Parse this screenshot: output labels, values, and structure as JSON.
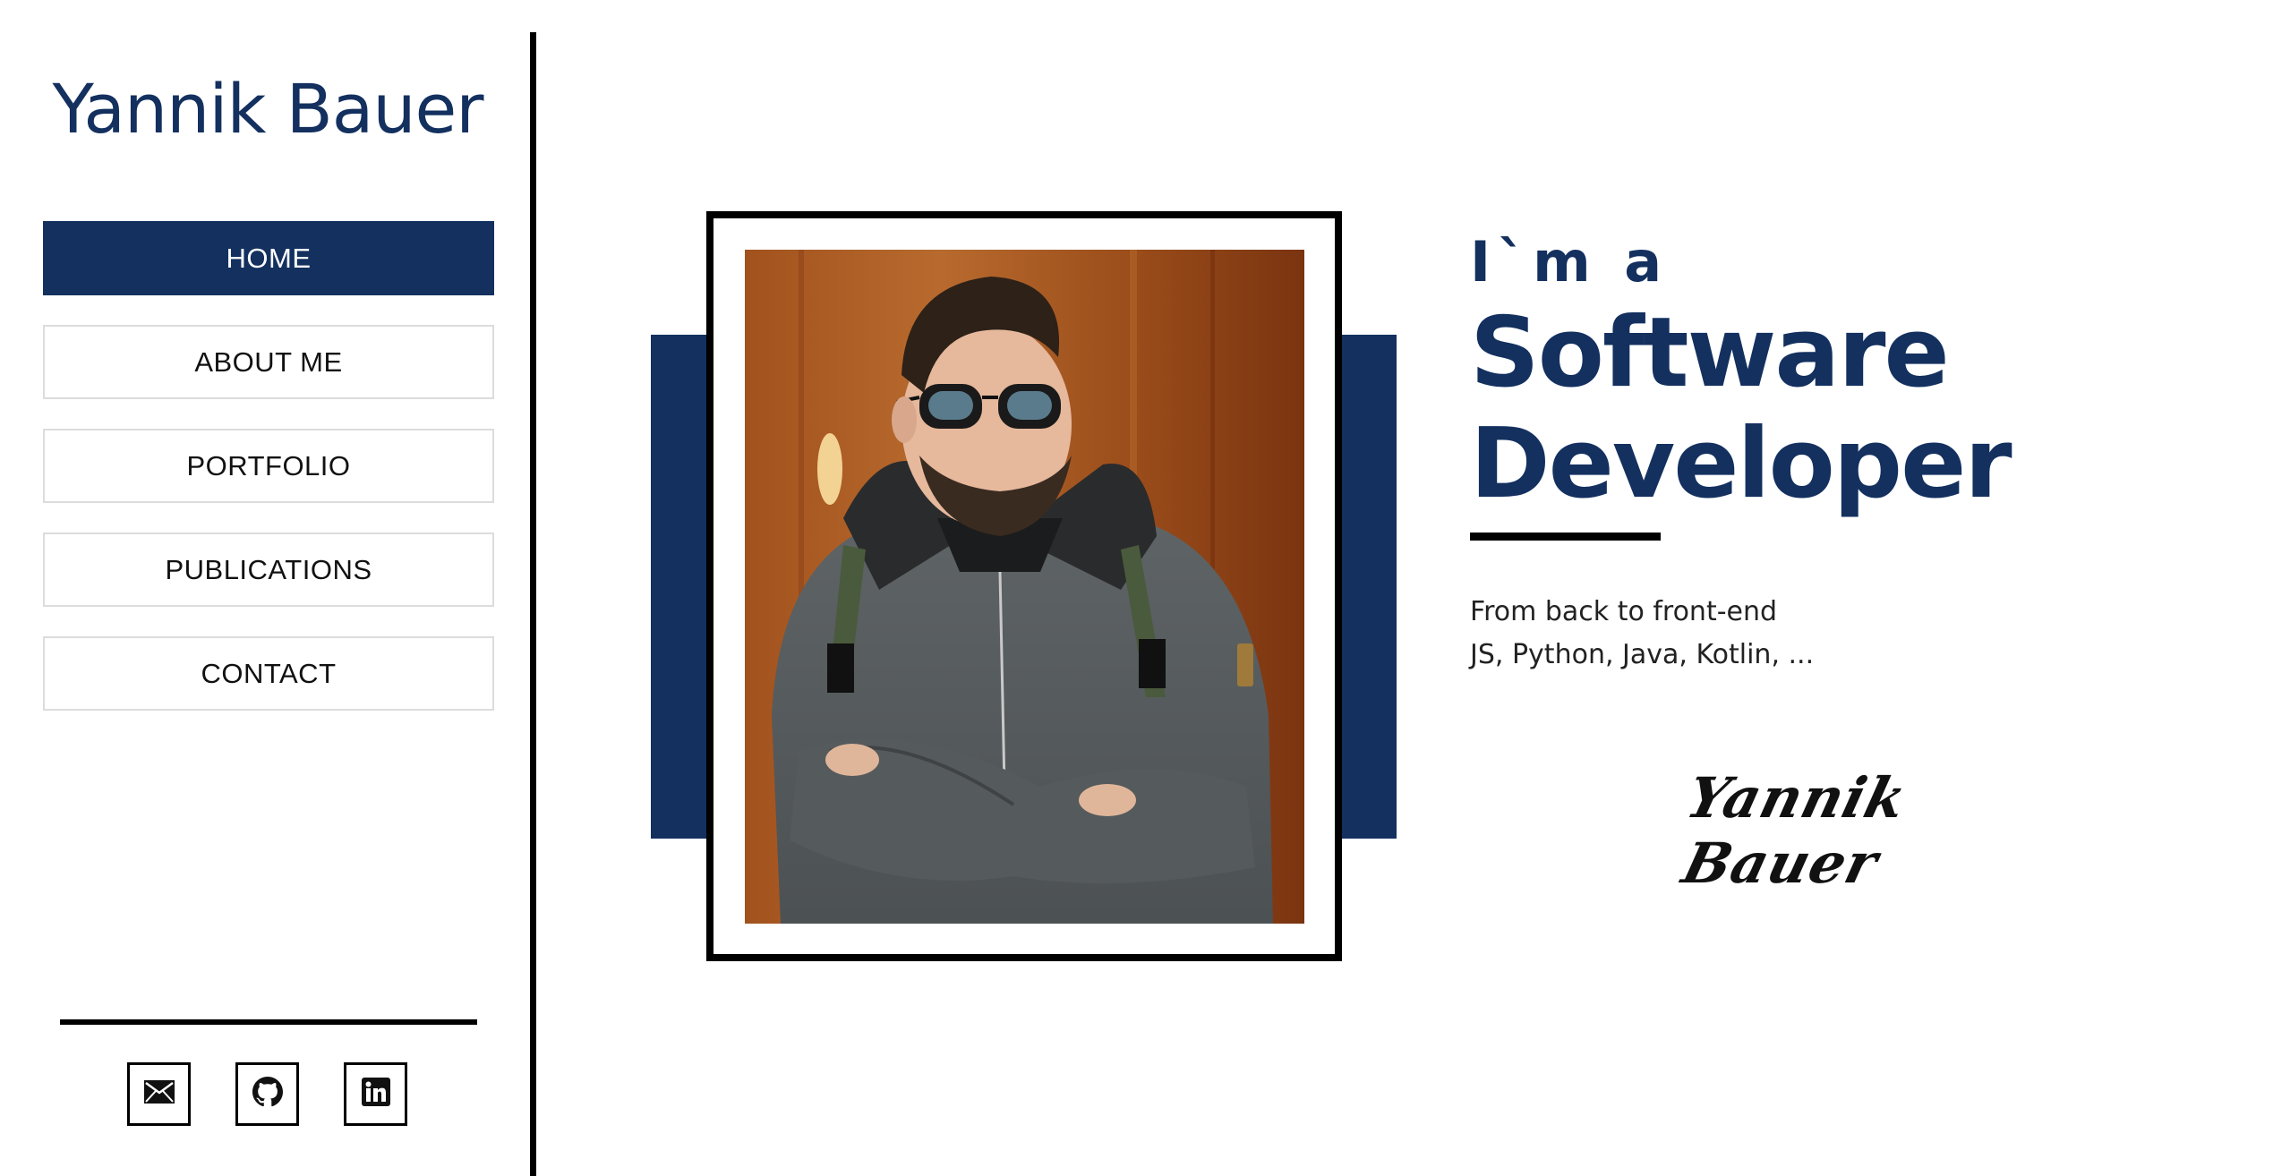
{
  "sidebar": {
    "brand": "Yannik Bauer",
    "nav": [
      {
        "label": "HOME",
        "active": true
      },
      {
        "label": "ABOUT ME",
        "active": false
      },
      {
        "label": "PORTFOLIO",
        "active": false
      },
      {
        "label": "PUBLICATIONS",
        "active": false
      },
      {
        "label": "CONTACT",
        "active": false
      }
    ],
    "social": [
      {
        "icon": "mail-icon"
      },
      {
        "icon": "github-icon"
      },
      {
        "icon": "linkedin-icon"
      }
    ]
  },
  "hero": {
    "intro": "I`m a",
    "title_line1": "Software",
    "title_line2": "Developer",
    "skills_line1": "From back to front-end",
    "skills_line2": "JS, Python, Java, Kotlin, ...",
    "signature": "Yannik Bauer",
    "photo_icon": "portrait-photo"
  },
  "colors": {
    "accent": "#13305f",
    "text": "#111111",
    "background": "#ffffff"
  }
}
